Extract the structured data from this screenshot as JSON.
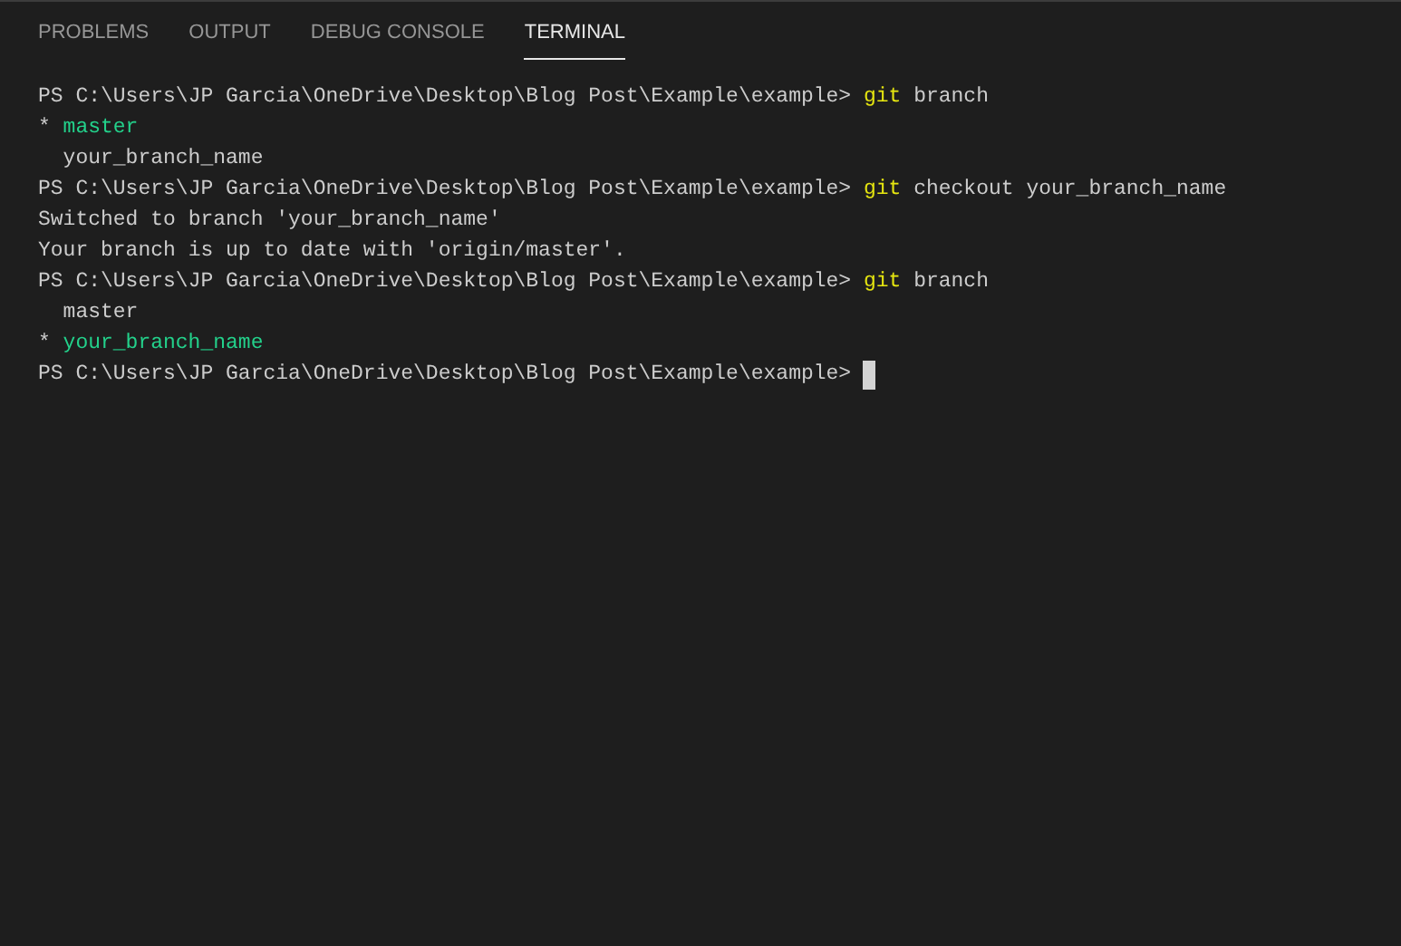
{
  "tabs": [
    {
      "label": "PROBLEMS",
      "selected": false
    },
    {
      "label": "OUTPUT",
      "selected": false
    },
    {
      "label": "DEBUG CONSOLE",
      "selected": false
    },
    {
      "label": "TERMINAL",
      "selected": true
    }
  ],
  "terminal": {
    "lines": [
      {
        "segments": [
          {
            "kind": "prompt",
            "text": "PS C:\\Users\\JP Garcia\\OneDrive\\Desktop\\Blog Post\\Example\\example>"
          },
          {
            "kind": "command",
            "text": "git"
          },
          {
            "kind": "plain",
            "text": "branch"
          }
        ]
      },
      {
        "segments": [
          {
            "kind": "plain",
            "text": "*"
          },
          {
            "kind": "current-branch",
            "text": "master"
          }
        ]
      },
      {
        "segments": [
          {
            "kind": "branch",
            "text": "your_branch_name"
          }
        ]
      },
      {
        "segments": [
          {
            "kind": "prompt",
            "text": "PS C:\\Users\\JP Garcia\\OneDrive\\Desktop\\Blog Post\\Example\\example>"
          },
          {
            "kind": "command",
            "text": "git"
          },
          {
            "kind": "plain",
            "text": "checkout your_branch_name"
          }
        ]
      },
      {
        "segments": [
          {
            "kind": "plain",
            "text": "Switched to branch 'your_branch_name'"
          }
        ]
      },
      {
        "segments": [
          {
            "kind": "plain",
            "text": "Your branch is up to date with 'origin/master'."
          }
        ]
      },
      {
        "segments": [
          {
            "kind": "prompt",
            "text": "PS C:\\Users\\JP Garcia\\OneDrive\\Desktop\\Blog Post\\Example\\example>"
          },
          {
            "kind": "command",
            "text": "git"
          },
          {
            "kind": "plain",
            "text": "branch"
          }
        ]
      },
      {
        "segments": [
          {
            "kind": "branch",
            "text": "master"
          }
        ]
      },
      {
        "segments": [
          {
            "kind": "plain",
            "text": "*"
          },
          {
            "kind": "current-branch",
            "text": "your_branch_name"
          }
        ]
      },
      {
        "segments": [
          {
            "kind": "prompt",
            "text": "PS C:\\Users\\JP Garcia\\OneDrive\\Desktop\\Blog Post\\Example\\example>"
          },
          {
            "kind": "cursor"
          }
        ]
      }
    ]
  }
}
